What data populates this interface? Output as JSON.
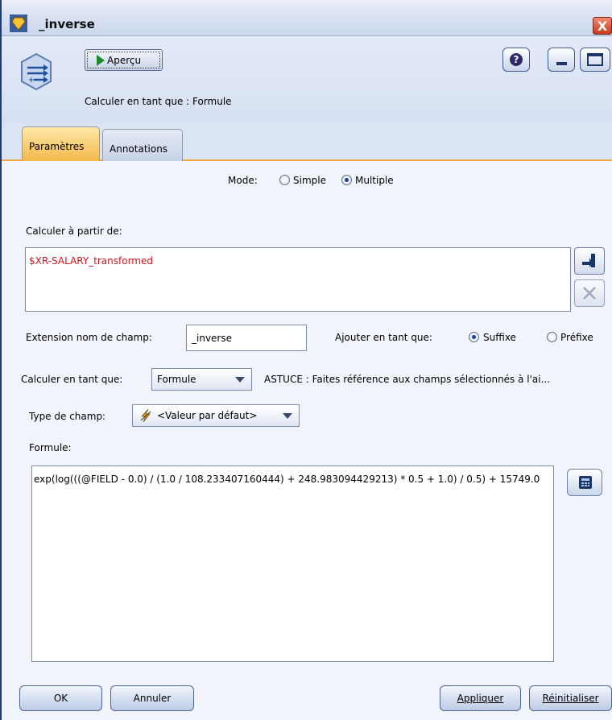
{
  "window": {
    "title": "_inverse",
    "close_glyph": "X"
  },
  "header": {
    "preview_label": "Aperçu",
    "help_glyph": "?",
    "compute_caption": "Calculer en tant que : Formule"
  },
  "tabs": [
    {
      "label": "Paramètres",
      "active": true
    },
    {
      "label": "Annotations",
      "active": false
    }
  ],
  "mode": {
    "label": "Mode:",
    "options": [
      {
        "label": "Simple",
        "selected": false
      },
      {
        "label": "Multiple",
        "selected": true
      }
    ]
  },
  "derive_from": {
    "label": "Calculer à partir de:",
    "fields": [
      "$XR-SALARY_transformed"
    ]
  },
  "extension": {
    "label": "Extension nom de champ:",
    "value": "_inverse",
    "add_as_label": "Ajouter en tant que:",
    "options": [
      {
        "label": "Suffixe",
        "selected": true
      },
      {
        "label": "Préfixe",
        "selected": false
      }
    ]
  },
  "compute_as": {
    "label": "Calculer en tant que:",
    "selected": "Formule",
    "hint": "ASTUCE : Faites référence aux champs sélectionnés à l'ai..."
  },
  "field_type": {
    "label": "Type de champ:",
    "selected": "<Valeur par défaut>"
  },
  "formula": {
    "label": "Formule:",
    "value": "exp(log(((@FIELD - 0.0) / (1.0 / 108.233407160444) + 248.983094429213) * 0.5 + 1.0) / 0.5) + 15749.0"
  },
  "footer": {
    "ok": "OK",
    "cancel": "Annuler",
    "apply": "Appliquer",
    "reset": "Réinitialiser"
  },
  "colors": {
    "accent_tab": "#f5b94c",
    "field_text": "#d0141e"
  }
}
